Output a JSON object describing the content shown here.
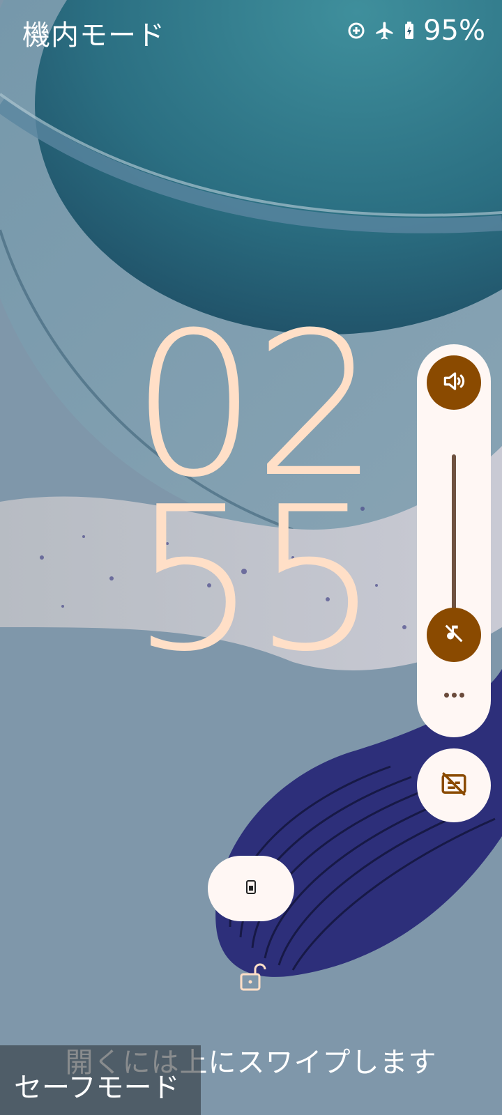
{
  "status_bar": {
    "carrier_text": "機内モード",
    "battery_percent": "95%",
    "icons": [
      "data-saver-icon",
      "airplane-mode-icon",
      "battery-charging-icon"
    ]
  },
  "clock": {
    "hours": "02",
    "minutes": "55"
  },
  "volume_panel": {
    "level": 0,
    "icons": [
      "volume-icon",
      "mute-icon",
      "more-icon"
    ]
  },
  "captions": {
    "icon": "captions-off-icon"
  },
  "shortcut": {
    "icon": "phone-icon"
  },
  "lock": {
    "icon": "unlock-icon"
  },
  "swipe_hint": "開くには上にスワイプします",
  "safe_mode_label": "セーフモード",
  "colors": {
    "clock": "#ffdfc7",
    "panel_bg": "#fff7f4",
    "accent": "#8a4a00",
    "wallpaper_bg": "#7f97aa"
  }
}
